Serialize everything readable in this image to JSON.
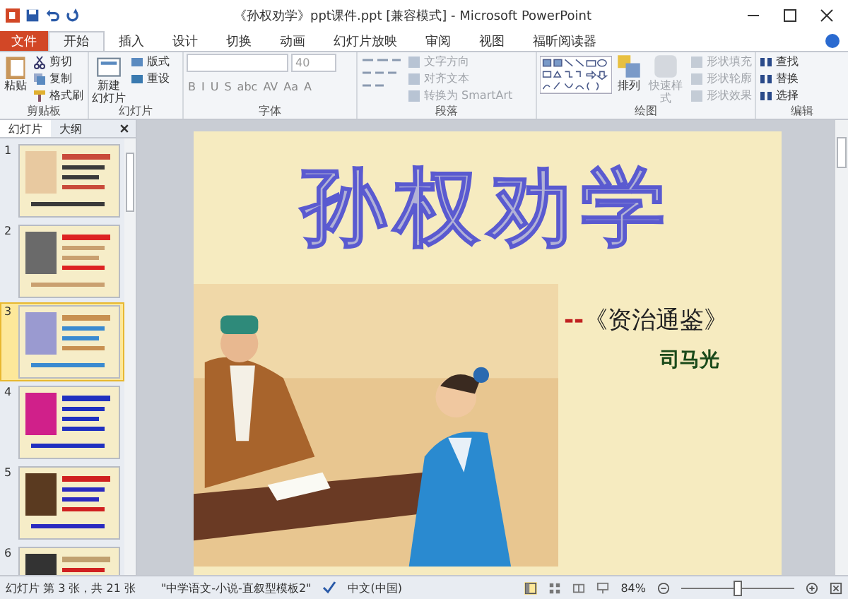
{
  "window": {
    "title": "《孙权劝学》ppt课件.ppt [兼容模式] - Microsoft PowerPoint"
  },
  "tabs": [
    {
      "label": "文件",
      "kind": "file",
      "selected": false
    },
    {
      "label": "开始",
      "kind": "tab",
      "selected": true
    },
    {
      "label": "插入",
      "kind": "tab",
      "selected": false
    },
    {
      "label": "设计",
      "kind": "tab",
      "selected": false
    },
    {
      "label": "切换",
      "kind": "tab",
      "selected": false
    },
    {
      "label": "动画",
      "kind": "tab",
      "selected": false
    },
    {
      "label": "幻灯片放映",
      "kind": "tab",
      "selected": false
    },
    {
      "label": "审阅",
      "kind": "tab",
      "selected": false
    },
    {
      "label": "视图",
      "kind": "tab",
      "selected": false
    },
    {
      "label": "福昕阅读器",
      "kind": "tab",
      "selected": false
    }
  ],
  "ribbon": {
    "clipboard": {
      "label": "剪贴板",
      "paste": "粘贴",
      "cut": "剪切",
      "copy": "复制",
      "format_painter": "格式刷"
    },
    "slides": {
      "label": "幻灯片",
      "new_slide": [
        "新建",
        "幻灯片"
      ],
      "layout": "版式",
      "reset": "重设"
    },
    "font": {
      "label": "字体",
      "size": "40",
      "formats": [
        "B",
        "I",
        "U",
        "S",
        "abc",
        "AV",
        "Aa",
        "A"
      ]
    },
    "paragraph": {
      "label": "段落",
      "items": [
        {
          "label": "文字方向",
          "disabled": true
        },
        {
          "label": "对齐文本",
          "disabled": true
        },
        {
          "label": "转换为 SmartArt",
          "disabled": true
        }
      ]
    },
    "drawing": {
      "label": "绘图",
      "arrange": "排列",
      "quick_styles": {
        "label": "快速样式",
        "disabled": true
      },
      "items": [
        {
          "label": "形状填充",
          "disabled": true
        },
        {
          "label": "形状轮廓",
          "disabled": true
        },
        {
          "label": "形状效果",
          "disabled": true
        }
      ]
    },
    "editing": {
      "label": "编辑",
      "items": [
        {
          "label": "查找"
        },
        {
          "label": "替换"
        },
        {
          "label": "选择"
        }
      ]
    }
  },
  "pane": {
    "tabs": [
      {
        "label": "幻灯片",
        "selected": true
      },
      {
        "label": "大纲",
        "selected": false
      }
    ],
    "slides": [
      {
        "number": "1",
        "selected": false
      },
      {
        "number": "2",
        "selected": false
      },
      {
        "number": "3",
        "selected": true
      },
      {
        "number": "4",
        "selected": false
      },
      {
        "number": "5",
        "selected": false
      },
      {
        "number": "6",
        "selected": false
      }
    ]
  },
  "slide": {
    "title": "孙权劝学",
    "subtitle_dash": "--",
    "subtitle": "《资治通鉴》",
    "author": "司马光"
  },
  "status_bar": {
    "slide_info": "幻灯片 第 3 张，共 21 张",
    "theme": "\"中学语文-小说-直叙型模板2\"",
    "language": "中文(中国)",
    "zoom": {
      "reading": "84%",
      "level": 0.5
    }
  }
}
